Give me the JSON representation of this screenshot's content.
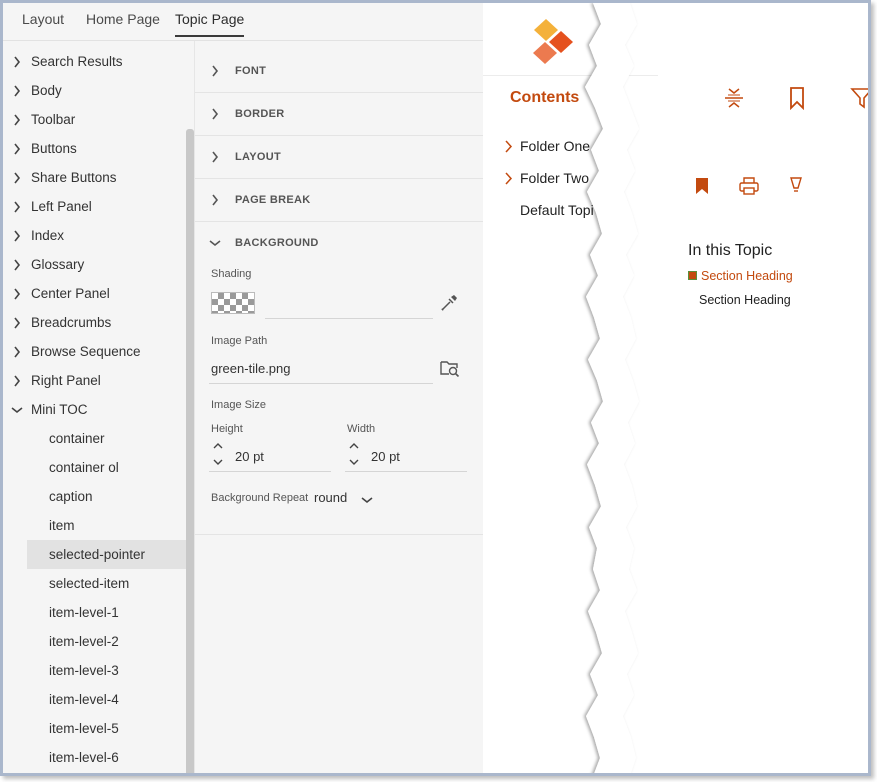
{
  "tabs": [
    {
      "label": "Layout"
    },
    {
      "label": "Home Page"
    },
    {
      "label": "Topic Page"
    }
  ],
  "tree": {
    "groups": [
      {
        "label": "Search Results"
      },
      {
        "label": "Body"
      },
      {
        "label": "Toolbar"
      },
      {
        "label": "Buttons"
      },
      {
        "label": "Share Buttons"
      },
      {
        "label": "Left Panel"
      },
      {
        "label": "Index"
      },
      {
        "label": "Glossary"
      },
      {
        "label": "Center Panel"
      },
      {
        "label": "Breadcrumbs"
      },
      {
        "label": "Browse Sequence"
      },
      {
        "label": "Right Panel"
      },
      {
        "label": "Mini TOC"
      }
    ],
    "children": [
      {
        "label": "container"
      },
      {
        "label": "container ol"
      },
      {
        "label": "caption"
      },
      {
        "label": "item"
      },
      {
        "label": "selected-pointer"
      },
      {
        "label": "selected-item"
      },
      {
        "label": "item-level-1"
      },
      {
        "label": "item-level-2"
      },
      {
        "label": "item-level-3"
      },
      {
        "label": "item-level-4"
      },
      {
        "label": "item-level-5"
      },
      {
        "label": "item-level-6"
      }
    ],
    "selected": "selected-pointer"
  },
  "sections": [
    {
      "label": "FONT"
    },
    {
      "label": "BORDER"
    },
    {
      "label": "LAYOUT"
    },
    {
      "label": "PAGE BREAK"
    },
    {
      "label": "BACKGROUND"
    }
  ],
  "background": {
    "shading_label": "Shading",
    "shading_value": "",
    "image_path_label": "Image Path",
    "image_path_value": "green-tile.png",
    "image_size_label": "Image Size",
    "height_label": "Height",
    "height_value": "20 pt",
    "width_label": "Width",
    "width_value": "20 pt",
    "repeat_label": "Background Repeat",
    "repeat_value": "round"
  },
  "preview": {
    "contents_title": "Contents",
    "toc": [
      {
        "label": "Folder One"
      },
      {
        "label": "Folder Two"
      },
      {
        "label": "Default Topi"
      }
    ],
    "right_panel_title": "In this Topic",
    "mini_toc_selected": "Section Heading",
    "mini_toc_item": "Section Heading"
  },
  "colors": {
    "accent": "#c34a0f",
    "editor_bg": "#f5f5f5",
    "selected_row": "#e2e2e2"
  },
  "icons": [
    "logo-icon",
    "expand-collapse-icon",
    "bookmark-icon",
    "filter-icon",
    "bookmark-filled-icon",
    "print-icon",
    "hint-icon",
    "eyedropper-icon",
    "browse-folder-icon"
  ]
}
